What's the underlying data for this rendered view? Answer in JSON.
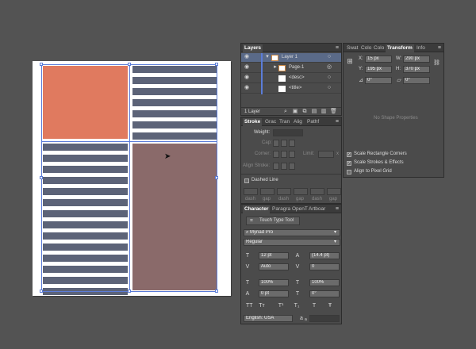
{
  "layers": {
    "tab": "Layers",
    "items": [
      {
        "name": "Layer 1"
      },
      {
        "name": "Page-1"
      },
      {
        "name": "<desc>"
      },
      {
        "name": "<title>"
      }
    ],
    "footer": "1 Layer"
  },
  "stroke_tabs": [
    "Stroke",
    "Grac",
    "Tran",
    "Alig",
    "Pathf"
  ],
  "stroke": {
    "weight_label": "Weight:",
    "cap_label": "Cap:",
    "corner_label": "Corner:",
    "limit_label": "Limit:",
    "limit_x": "x",
    "align_label": "Align Stroke:",
    "dashed_label": "Dashed Line",
    "dash_labels": [
      "dash",
      "gap",
      "dash",
      "gap",
      "dash",
      "gap"
    ]
  },
  "right_tabs": [
    "Swat",
    "Colo",
    "Colo",
    "Transform",
    "Info"
  ],
  "transform": {
    "x_label": "X:",
    "x_value": "15 px",
    "w_label": "W:",
    "w_value": "290 px",
    "y_label": "Y:",
    "y_value": "195 px",
    "h_label": "H:",
    "h_value": "370 px",
    "rotate_value": "0°",
    "shear_value": "0°",
    "no_shape": "No Shape Properties",
    "options": [
      {
        "label": "Scale Rectangle Corners",
        "checked": true
      },
      {
        "label": "Scale Strokes & Effects",
        "checked": true
      },
      {
        "label": "Align to Pixel Grid",
        "checked": false
      }
    ]
  },
  "char_tabs": [
    "Character",
    "Paragra",
    "OpenT",
    "Artboar"
  ],
  "character": {
    "touch_type": "Touch Type Tool",
    "font_family": "Myriad Pro",
    "font_style": "Regular",
    "size": "12 pt",
    "leading": "(14.4 pt)",
    "kerning": "Auto",
    "tracking": "0",
    "vscale": "100%",
    "hscale": "100%",
    "baseline": "0 pt",
    "rotation": "0°",
    "language": "English: USA",
    "aa_label": "a"
  },
  "colors": {
    "background": "#535353",
    "orange_rect": "#e07a5f",
    "mauve_rect": "#8a6a6a",
    "stripe": "#5c6378",
    "selection": "#5b7cd8"
  }
}
